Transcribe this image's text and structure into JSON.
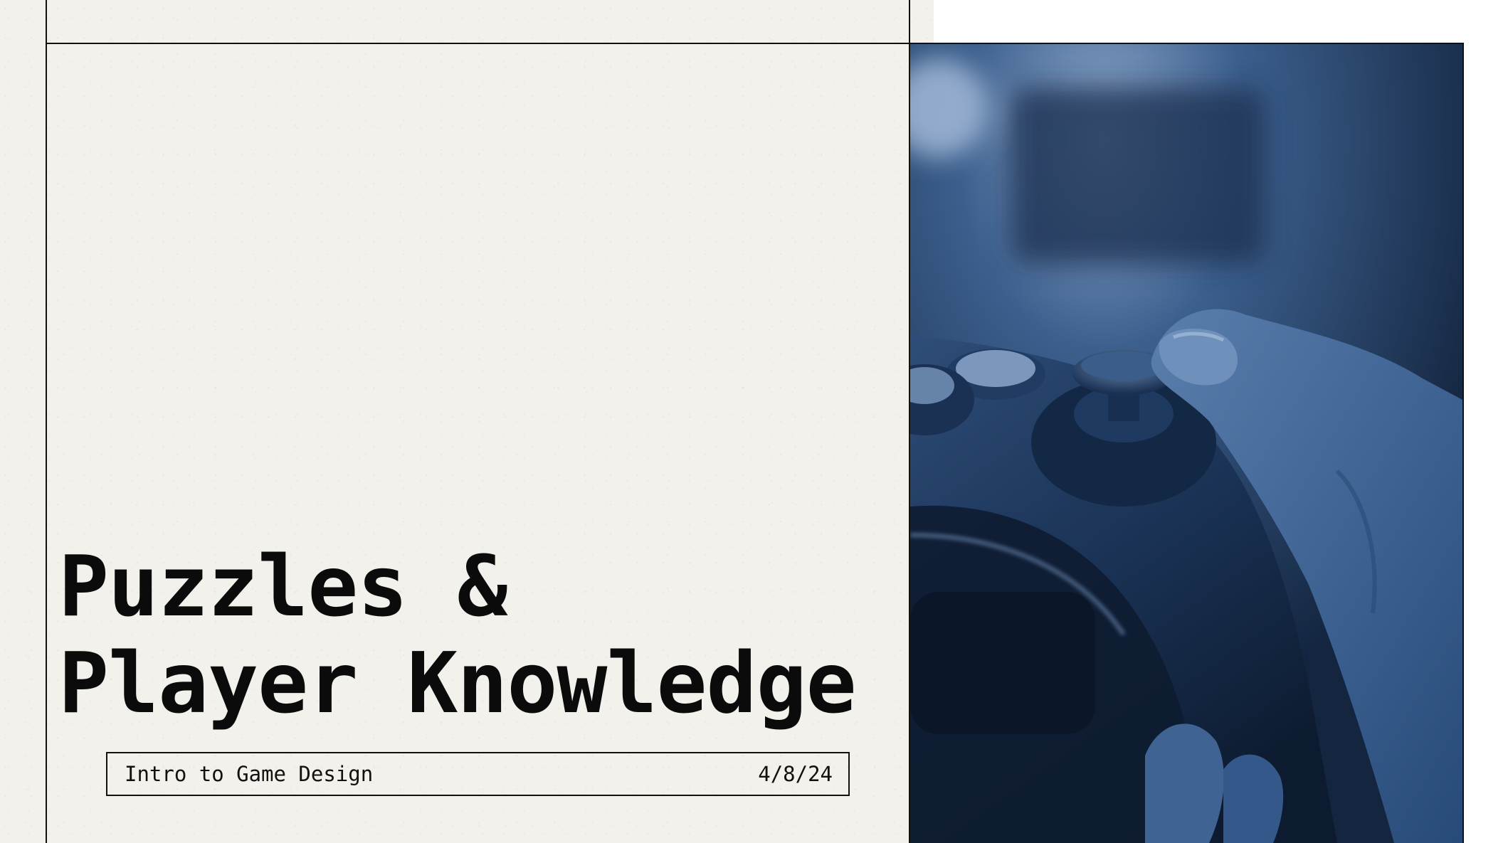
{
  "slide": {
    "title_line1": "Puzzles &",
    "title_line2": "Player Knowledge",
    "subtitle": "Intro to Game Design",
    "date": "4/8/24"
  },
  "photo": {
    "subject": "hand-on-game-controller",
    "tint_color": "#2b4e7e"
  },
  "colors": {
    "paper": "#f3f1ec",
    "ink": "#0b0b0b",
    "photo_shadow": "#13253f",
    "photo_highlight": "#9fb7d6"
  }
}
